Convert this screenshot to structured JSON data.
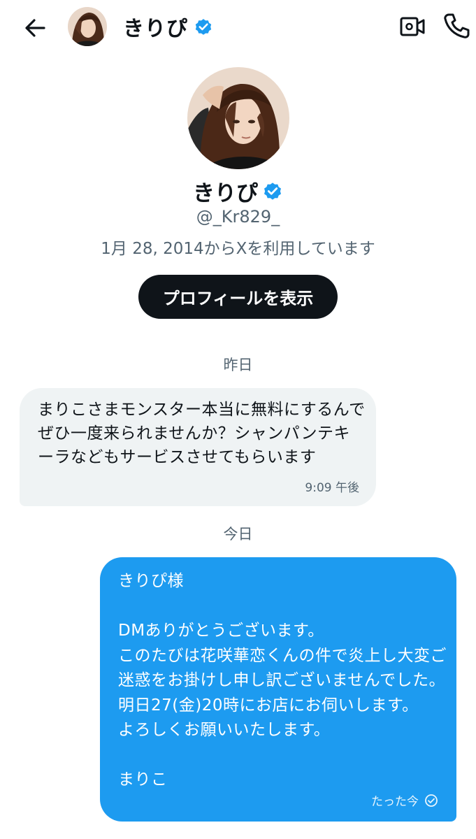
{
  "header": {
    "back_icon": "arrow-left-icon",
    "name": "きりぴ",
    "verified_icon": "verified-badge-icon",
    "video_icon": "video-call-icon",
    "phone_icon": "phone-call-icon"
  },
  "profile": {
    "name": "きりぴ",
    "handle": "@_Kr829_",
    "joined": "1月 28, 2014からXを利用しています",
    "view_profile_label": "プロフィールを表示"
  },
  "conversation": {
    "day_yesterday": "昨日",
    "day_today": "今日",
    "messages": [
      {
        "direction": "incoming",
        "text": "まりこさまモンスター本当に無料にするんでぜひ一度来られませんか？シャンパンテキーラなどもサービスさせてもらいます",
        "time": "9:09 午後"
      },
      {
        "direction": "outgoing",
        "text": "きりぴ様\n\nDMありがとうございます。\nこのたびは花咲華恋くんの件で炎上し大変ご迷惑をお掛けし申し訳ございませんでした。\n明日27(金)20時にお店にお伺いします。\nよろしくお願いいたします。\n\nまりこ",
        "time": "たった今",
        "status_icon": "sent-check-icon"
      }
    ]
  },
  "colors": {
    "accent": "#1d9bf0",
    "incoming_bubble": "#eff3f4",
    "secondary_text": "#536471",
    "primary_text": "#0f1419"
  }
}
